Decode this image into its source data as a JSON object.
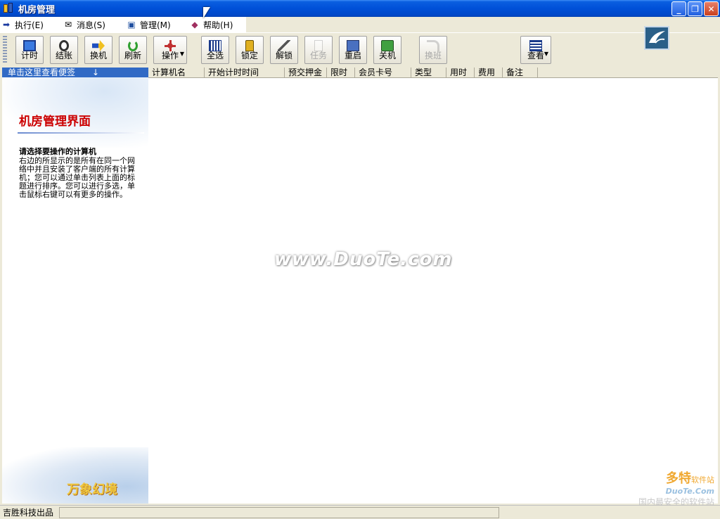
{
  "window": {
    "title": "机房管理"
  },
  "menu": [
    {
      "label": "执行(E)",
      "icon": "arrow-right-icon"
    },
    {
      "label": "消息(S)",
      "icon": "envelope-icon"
    },
    {
      "label": "管理(M)",
      "icon": "computer-icon"
    },
    {
      "label": "帮助(H)",
      "icon": "book-icon"
    }
  ],
  "toolbar": {
    "timing": "计时",
    "checkout": "结账",
    "switch_pc": "换机",
    "refresh": "刷新",
    "operate": "操作",
    "select_all": "全选",
    "lock": "锁定",
    "unlock": "解锁",
    "task": "任务",
    "restart": "重启",
    "shutdown": "关机",
    "shift_change": "换班",
    "view": "查看"
  },
  "left_header": {
    "label": "单击这里查看便签",
    "arrow": "↓"
  },
  "columns": [
    "计算机名",
    "开始计时时间",
    "预交押金",
    "限时",
    "会员卡号",
    "类型",
    "用时",
    "费用",
    "备注"
  ],
  "panel": {
    "title": "机房管理界面",
    "subtitle": "请选择要操作的计算机",
    "description": "右边的所显示的是所有在同一个网络中并且安装了客户端的所有计算机；您可以通过单击列表上面的标题进行排序。您可以进行多选，单击鼠标右键可以有更多的操作。",
    "brand": "万象幻境"
  },
  "watermark": {
    "main": "www.DuoTe.com",
    "corner_top": "多特",
    "corner_small": "软件站",
    "corner_url": "DuoTe.Com",
    "corner_tagline": "国内最安全的软件站"
  },
  "status": {
    "text": "吉胜科技出品"
  }
}
